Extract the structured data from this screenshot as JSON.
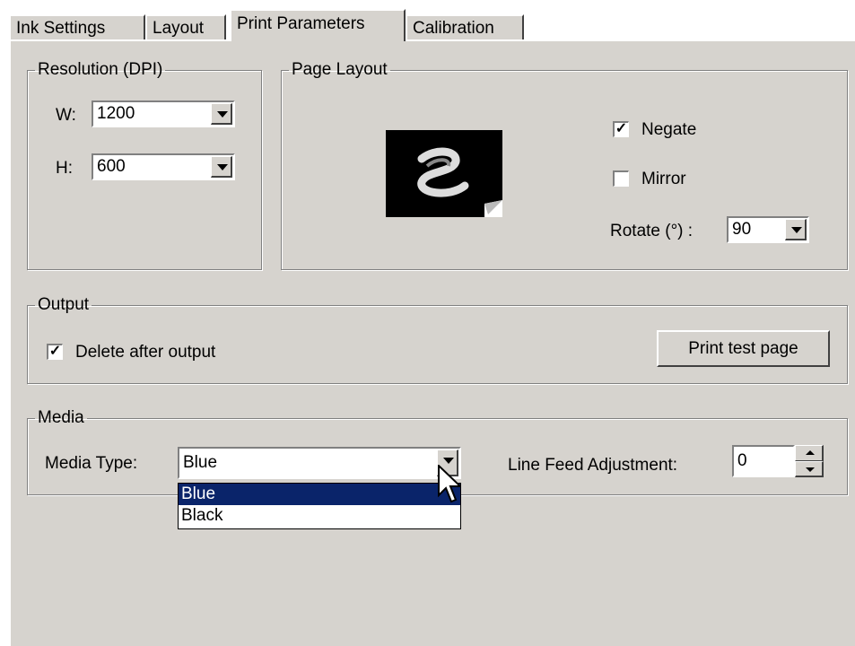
{
  "tabs": [
    {
      "label": "Ink Settings"
    },
    {
      "label": "Layout"
    },
    {
      "label": "Print Parameters"
    },
    {
      "label": "Calibration"
    }
  ],
  "resolution": {
    "legend": "Resolution (DPI)",
    "w_label": "W:",
    "w_value": "1200",
    "h_label": "H:",
    "h_value": "600"
  },
  "page_layout": {
    "legend": "Page Layout",
    "negate_label": "Negate",
    "negate_checked": true,
    "mirror_label": "Mirror",
    "mirror_checked": false,
    "rotate_label": "Rotate (°) :",
    "rotate_value": "90"
  },
  "output": {
    "legend": "Output",
    "delete_label": "Delete after output",
    "delete_checked": true,
    "print_test_label": "Print test page"
  },
  "media": {
    "legend": "Media",
    "type_label": "Media Type:",
    "type_value": "Blue",
    "options": [
      "Blue",
      "Black"
    ],
    "line_feed_label": "Line Feed Adjustment:",
    "line_feed_value": "0"
  },
  "colors": {
    "panel": "#d6d3ce",
    "selection": "#0a246a"
  }
}
